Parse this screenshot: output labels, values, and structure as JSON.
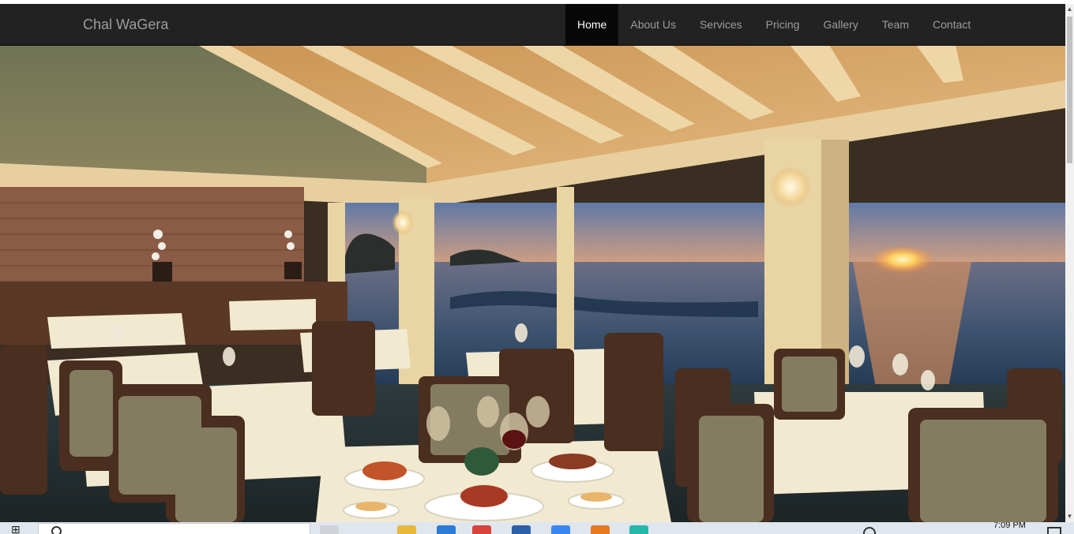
{
  "navbar": {
    "brand": "Chal WaGera",
    "items": [
      {
        "label": "Home",
        "active": true
      },
      {
        "label": "About Us"
      },
      {
        "label": "Services"
      },
      {
        "label": "Pricing"
      },
      {
        "label": "Gallery"
      },
      {
        "label": "Team"
      },
      {
        "label": "Contact"
      }
    ]
  },
  "hero": {
    "image": "restaurant-sunset-ocean-view"
  },
  "taskbar": {
    "clock": "7:09 PM"
  },
  "colors": {
    "navbar_bg": "#222222",
    "nav_active_bg": "#080808",
    "nav_text": "#9d9d9d",
    "nav_active_text": "#ffffff"
  }
}
